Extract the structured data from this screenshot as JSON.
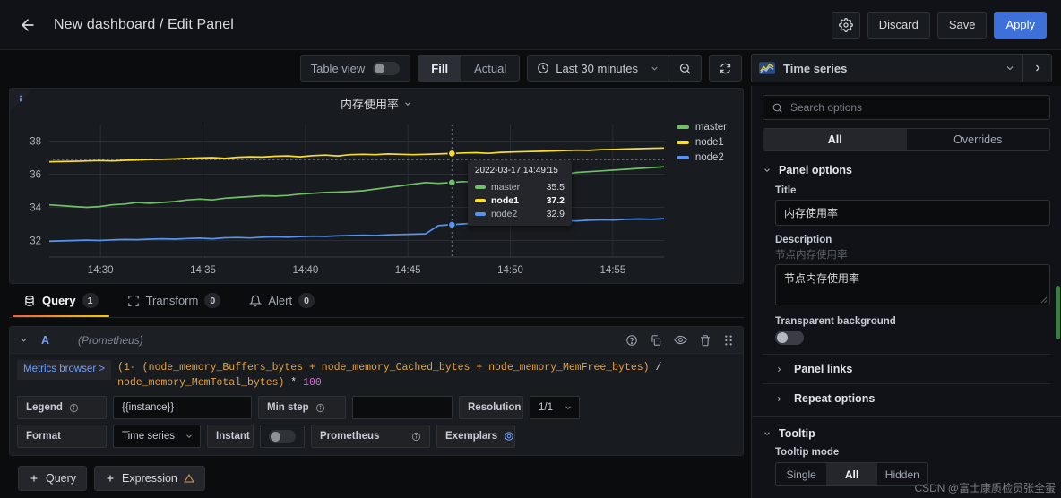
{
  "header": {
    "back_icon": "arrow-left-icon",
    "breadcrumb": "New dashboard / Edit Panel",
    "settings_icon": "gear-icon",
    "discard_label": "Discard",
    "save_label": "Save",
    "apply_label": "Apply"
  },
  "toolbar": {
    "table_view_label": "Table view",
    "fill_label": "Fill",
    "actual_label": "Actual",
    "clock_icon": "clock-icon",
    "time_range": "Last 30 minutes",
    "chevron_icon": "chevron-down-icon",
    "zoom_out_icon": "zoom-out-icon",
    "refresh_icon": "refresh-icon",
    "viz_icon": "time-series-icon",
    "viz_name": "Time series",
    "viz_chevron_icon": "chevron-down-icon",
    "viz_next_icon": "chevron-right-icon"
  },
  "panel": {
    "info_icon": "info-icon",
    "title": "内存使用率",
    "title_chevron_icon": "chevron-down-icon"
  },
  "chart_data": {
    "type": "line",
    "title": "内存使用率",
    "xlabel": "",
    "ylabel": "",
    "ylim": [
      31.0,
      39.0
    ],
    "yticks": [
      32,
      34,
      36,
      38
    ],
    "xticks": [
      "14:30",
      "14:35",
      "14:40",
      "14:45",
      "14:50",
      "14:55"
    ],
    "grid": true,
    "legend_position": "right",
    "series": [
      {
        "name": "master",
        "color": "#73bf69",
        "values": [
          34.15,
          34.1,
          34.05,
          34.0,
          34.05,
          34.15,
          34.2,
          34.3,
          34.25,
          34.3,
          34.35,
          34.45,
          34.5,
          34.45,
          34.55,
          34.6,
          34.65,
          34.7,
          34.68,
          34.72,
          34.8,
          34.85,
          34.9,
          34.92,
          34.95,
          35.0,
          35.1,
          35.2,
          35.3,
          35.4,
          35.5,
          35.45,
          35.5,
          35.55,
          35.52,
          35.58,
          35.6,
          35.65,
          35.7,
          35.8,
          35.9,
          36.0,
          36.1,
          36.15,
          36.2,
          36.25,
          36.3,
          36.35,
          36.4,
          36.45
        ]
      },
      {
        "name": "node1",
        "color": "#fade2a",
        "values": [
          36.75,
          36.76,
          36.78,
          36.8,
          36.82,
          36.8,
          36.84,
          36.86,
          36.88,
          36.9,
          36.92,
          36.95,
          36.98,
          37.0,
          36.95,
          37.02,
          37.05,
          37.03,
          37.08,
          37.1,
          37.05,
          37.12,
          37.15,
          37.1,
          37.18,
          37.2,
          37.18,
          37.22,
          37.2,
          37.18,
          37.2,
          37.22,
          37.25,
          37.28,
          37.3,
          37.26,
          37.32,
          37.34,
          37.36,
          37.38,
          37.4,
          37.42,
          37.45,
          37.44,
          37.48,
          37.5,
          37.52,
          37.54,
          37.56,
          37.58
        ]
      },
      {
        "name": "node2",
        "color": "#5794f2",
        "values": [
          31.95,
          31.98,
          32.0,
          32.02,
          32.0,
          32.04,
          32.06,
          32.05,
          32.08,
          32.1,
          32.08,
          32.12,
          32.14,
          32.1,
          32.16,
          32.18,
          32.15,
          32.2,
          32.22,
          32.2,
          32.24,
          32.26,
          32.25,
          32.28,
          32.3,
          32.32,
          32.3,
          32.34,
          32.36,
          32.38,
          32.4,
          32.9,
          32.95,
          33.0,
          33.05,
          33.08,
          33.1,
          33.12,
          33.15,
          33.12,
          33.18,
          33.2,
          33.18,
          33.22,
          33.25,
          33.24,
          33.28,
          33.3,
          33.28,
          33.32
        ]
      }
    ],
    "threshold_line": {
      "value": 36.9,
      "color": "#8e8e94",
      "style": "dotted"
    },
    "cursor": {
      "x_label": "14:49:15",
      "x_fraction": 0.655
    }
  },
  "tooltip": {
    "timestamp": "2022-03-17 14:49:15",
    "rows": [
      {
        "name": "master",
        "value": "35.5",
        "color": "#73bf69",
        "bold": false
      },
      {
        "name": "node1",
        "value": "37.2",
        "color": "#fade2a",
        "bold": true
      },
      {
        "name": "node2",
        "value": "32.9",
        "color": "#5794f2",
        "bold": false
      }
    ]
  },
  "query_tabs": [
    {
      "label": "Query",
      "count": "1",
      "icon": "database-icon",
      "active": true
    },
    {
      "label": "Transform",
      "count": "0",
      "icon": "transform-icon",
      "active": false
    },
    {
      "label": "Alert",
      "count": "0",
      "icon": "bell-icon",
      "active": false
    }
  ],
  "query": {
    "collapse_icon": "chevron-down-icon",
    "ref_id": "A",
    "datasource": "(Prometheus)",
    "actions": [
      "help-icon",
      "duplicate-icon",
      "eye-icon",
      "trash-icon",
      "drag-handle-icon"
    ],
    "metrics_browser_label": "Metrics browser >",
    "expression_line1_a": "(1- ",
    "expression_line1_b": "(node_memory_Buffers_bytes + node_memory_Cached_bytes + node_memory_MemFree_bytes)",
    "expression_line1_c": " /",
    "expression_line2_a": "node_memory_MemTotal_bytes)",
    "expression_line2_b": " * ",
    "expression_line2_c": "100",
    "legend_label": "Legend",
    "legend_value": "{{instance}}",
    "min_step_label": "Min step",
    "min_step_value": "",
    "resolution_label": "Resolution",
    "resolution_value": "1/1",
    "format_label": "Format",
    "format_value": "Time series",
    "instant_label": "Instant",
    "prometheus_label": "Prometheus",
    "exemplars_label": "Exemplars",
    "info_icon": "info-circle-icon"
  },
  "query_footer": {
    "add_query_label": "Query",
    "add_expression_label": "Expression",
    "plus_icon": "plus-icon",
    "warning_icon": "warning-triangle-icon"
  },
  "options_pane": {
    "search_icon": "search-icon",
    "search_placeholder": "Search options",
    "tab_all": "All",
    "tab_overrides": "Overrides",
    "panel_options_label": "Panel options",
    "title_label": "Title",
    "title_value": "内存使用率",
    "description_label": "Description",
    "description_ghost": "节点内存使用率",
    "description_value": "节点内存使用率",
    "transparent_label": "Transparent background",
    "panel_links_label": "Panel links",
    "repeat_options_label": "Repeat options",
    "tooltip_section_label": "Tooltip",
    "tooltip_mode_label": "Tooltip mode",
    "tooltip_modes": [
      "Single",
      "All",
      "Hidden"
    ],
    "tooltip_mode_selected": "All"
  },
  "watermark": "CSDN @富士康质检员张全蛋",
  "colors": {
    "accent": "#3d71d9",
    "link": "#6e9fff",
    "series_green": "#73bf69",
    "series_yellow": "#fade2a",
    "series_blue": "#5794f2"
  }
}
